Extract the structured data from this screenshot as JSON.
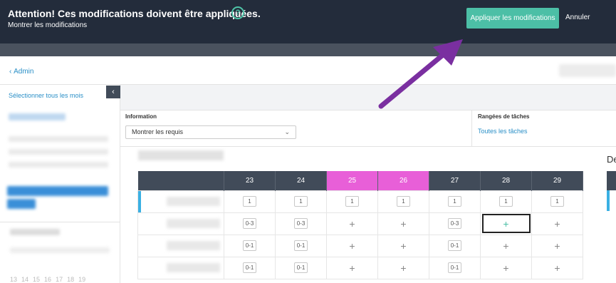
{
  "attention": {
    "title": "Attention! Ces modifications doivent être appliquées.",
    "help_icon": "question-circle-icon",
    "show_changes": "Montrer les modifications",
    "apply_label": "Appliquer les modifications",
    "cancel_label": "Annuler"
  },
  "header": {
    "back_label": "Admin",
    "back_icon": "chevron-left-icon"
  },
  "sidebar": {
    "select_all_months": "Sélectionner tous les mois",
    "collapse_icon": "chevron-left-icon",
    "day_numbers": [
      "13",
      "14",
      "15",
      "16",
      "17",
      "18",
      "19"
    ]
  },
  "filters": {
    "information_label": "Information",
    "information_value": "Montrer les requis",
    "task_rows_label": "Rangées de tâches",
    "task_rows_link": "Toutes les tâches"
  },
  "grid": {
    "next_label": "De",
    "days": [
      "23",
      "24",
      "25",
      "26",
      "27",
      "28",
      "29"
    ],
    "weekend_days": [
      "25",
      "26"
    ],
    "rows": [
      [
        "1",
        "1",
        "1",
        "1",
        "1",
        "1",
        "1"
      ],
      [
        "0-3",
        "0-3",
        "+",
        "+",
        "0-3",
        "+",
        "+"
      ],
      [
        "0-1",
        "0-1",
        "+",
        "+",
        "0-1",
        "+",
        "+"
      ],
      [
        "0-1",
        "0-1",
        "+",
        "+",
        "0-1",
        "+",
        "+"
      ]
    ],
    "selected_cell": {
      "row": 1,
      "col": 5
    }
  },
  "colors": {
    "topbar": "#232c3b",
    "accent_green": "#4cbfa6",
    "weekend_pink": "#e85fd8",
    "header_dark": "#414b59",
    "link_blue": "#2a8fc7",
    "arrow_purple": "#7a2fa0"
  }
}
